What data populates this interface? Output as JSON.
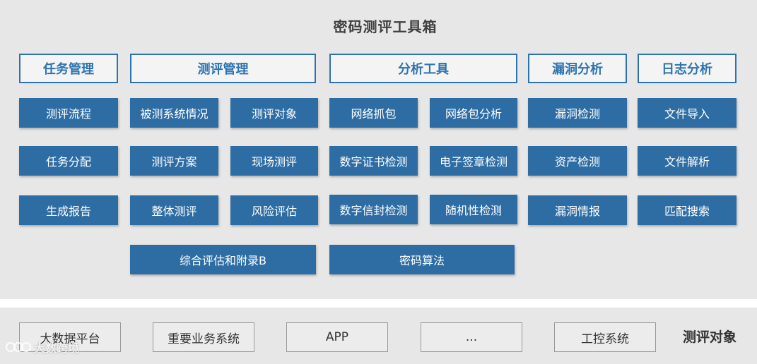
{
  "title": "密码测评工具箱",
  "colors": {
    "accent": "#2e6da4",
    "header_border": "#2e73b0",
    "panel_bg": "#e7e7e7"
  },
  "columns": [
    {
      "header": "任务管理",
      "items": [
        "测评流程",
        "任务分配",
        "生成报告"
      ]
    },
    {
      "header": "测评管理",
      "items": [
        "被测系统情况",
        "测评对象",
        "测评方案",
        "现场测评",
        "整体测评",
        "风险评估",
        "综合评估和附录B"
      ]
    },
    {
      "header": "分析工具",
      "items": [
        "网络抓包",
        "网络包分析",
        "数字证书检测",
        "电子签章检测",
        "数字信封检测",
        "随机性检测",
        "密码算法"
      ]
    },
    {
      "header": "漏洞分析",
      "items": [
        "漏洞检测",
        "资产检测",
        "漏洞情报"
      ]
    },
    {
      "header": "日志分析",
      "items": [
        "文件导入",
        "文件解析",
        "匹配搜索"
      ]
    }
  ],
  "targets": {
    "items": [
      "大数据平台",
      "重要业务系统",
      "APP",
      "...",
      "工控系统"
    ],
    "label": "测评对象"
  },
  "watermark": {
    "text": "大数跨境",
    "icon": "logo-icon"
  }
}
